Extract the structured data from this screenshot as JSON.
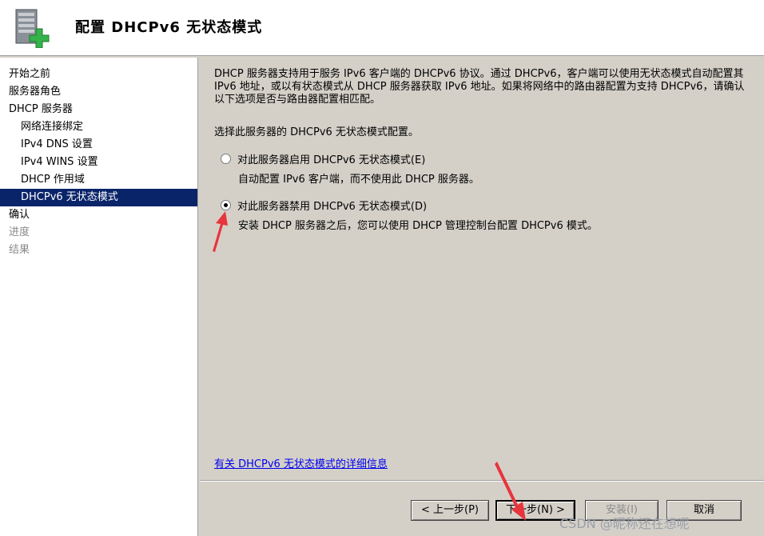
{
  "header": {
    "title": "配置 DHCPv6 无状态模式",
    "icon": "server-add-icon"
  },
  "sidebar": {
    "items": [
      {
        "label": "开始之前",
        "level": 0,
        "state": "normal"
      },
      {
        "label": "服务器角色",
        "level": 0,
        "state": "normal"
      },
      {
        "label": "DHCP 服务器",
        "level": 0,
        "state": "normal"
      },
      {
        "label": "网络连接绑定",
        "level": 1,
        "state": "normal"
      },
      {
        "label": "IPv4 DNS 设置",
        "level": 1,
        "state": "normal"
      },
      {
        "label": "IPv4 WINS 设置",
        "level": 1,
        "state": "normal"
      },
      {
        "label": "DHCP 作用域",
        "level": 1,
        "state": "normal"
      },
      {
        "label": "DHCPv6 无状态模式",
        "level": 1,
        "state": "selected"
      },
      {
        "label": "确认",
        "level": 0,
        "state": "normal"
      },
      {
        "label": "进度",
        "level": 0,
        "state": "disabled"
      },
      {
        "label": "结果",
        "level": 0,
        "state": "disabled"
      }
    ]
  },
  "main": {
    "description": "DHCP 服务器支持用于服务 IPv6 客户端的 DHCPv6 协议。通过 DHCPv6，客户端可以使用无状态模式自动配置其 IPv6 地址，或以有状态模式从 DHCP 服务器获取 IPv6 地址。如果将网络中的路由器配置为支持 DHCPv6，请确认以下选项是否与路由器配置相匹配。",
    "select_label": "选择此服务器的 DHCPv6 无状态模式配置。",
    "options": [
      {
        "label": "对此服务器启用 DHCPv6 无状态模式(E)",
        "description": "自动配置 IPv6 客户端，而不使用此 DHCP 服务器。",
        "checked": false
      },
      {
        "label": "对此服务器禁用 DHCPv6 无状态模式(D)",
        "description": "安装 DHCP 服务器之后，您可以使用 DHCP 管理控制台配置 DHCPv6 模式。",
        "checked": true
      }
    ],
    "link": "有关 DHCPv6 无状态模式的详细信息"
  },
  "buttons": {
    "back": "< 上一步(P)",
    "next": "下一步(N) >",
    "install": "安装(I)",
    "cancel": "取消"
  },
  "watermark": "CSDN @昵称还在想呢",
  "colors": {
    "selection": "#0a246a",
    "annotation_arrow": "#e8343d",
    "window_bg": "#d4d0c8",
    "link": "#0000ee"
  }
}
